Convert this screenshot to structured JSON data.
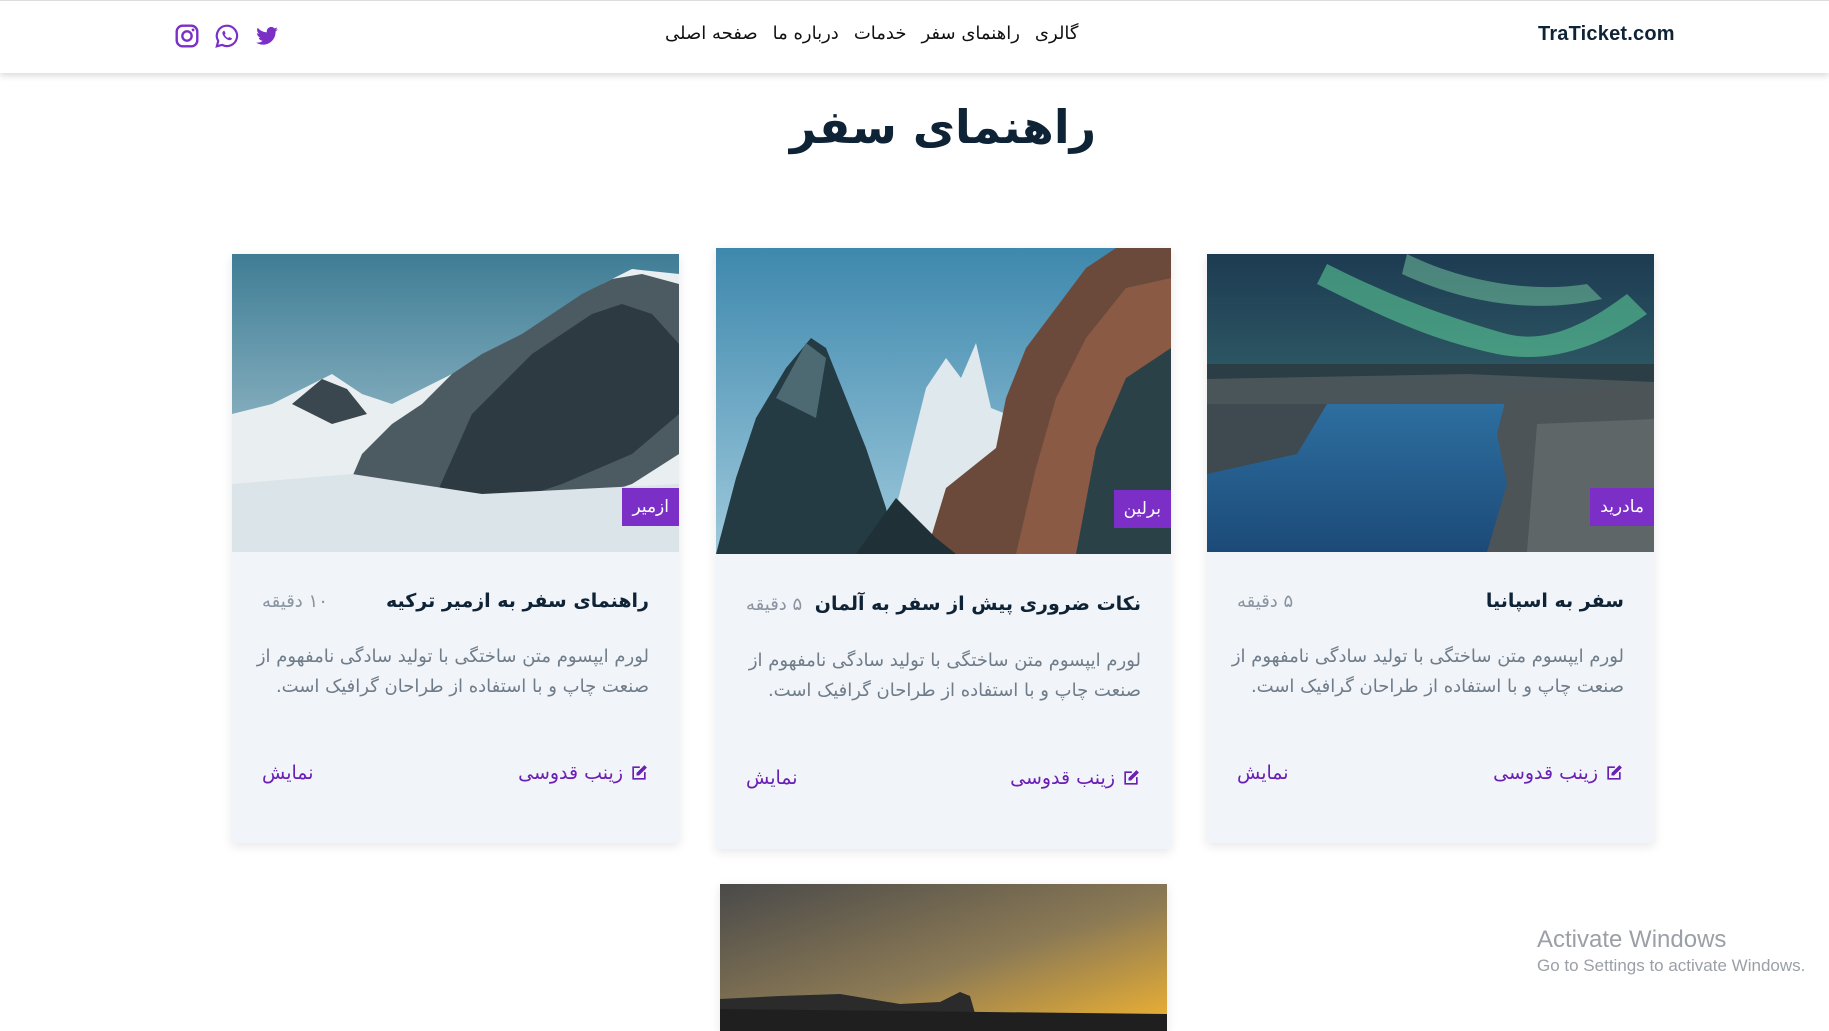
{
  "header": {
    "brand": "TraTicket.com",
    "nav": [
      "صفحه اصلی",
      "درباره ما",
      "خدمات",
      "راهنمای سفر",
      "گالری"
    ],
    "socials": [
      "twitter-icon",
      "whatsapp-icon",
      "instagram-icon"
    ],
    "accent": "#7b2fc6"
  },
  "page": {
    "title": "راهنمای سفر"
  },
  "cards": [
    {
      "tag": "مادرید",
      "title": "سفر به اسپانیا",
      "time": "۵ دقیقه",
      "desc": "لورم ایپسوم متن ساختگی با تولید سادگی نامفهوم از صنعت چاپ و با استفاده از طراحان گرافیک است.",
      "author": "زینب قدوسی",
      "action": "نمایش",
      "image": "aurora-river-photo"
    },
    {
      "tag": "برلین",
      "title": "نکات ضروری پیش از سفر به آلمان",
      "time": "۵ دقیقه",
      "desc": "لورم ایپسوم متن ساختگی با تولید سادگی نامفهوم از صنعت چاپ و با استفاده از طراحان گرافیک است.",
      "author": "زینب قدوسی",
      "action": "نمایش",
      "image": "rocky-peaks-photo"
    },
    {
      "tag": "ازمیر",
      "title": "راهنمای سفر به ازمیر ترکیه",
      "time": "۱۰ دقیقه",
      "desc": "لورم ایپسوم متن ساختگی با تولید سادگی نامفهوم از صنعت چاپ و با استفاده از طراحان گرافیک است.",
      "author": "زینب قدوسی",
      "action": "نمایش",
      "image": "snowy-mountains-photo"
    }
  ],
  "watermark": {
    "line1": "Activate Windows",
    "line2": "Go to Settings to activate Windows."
  }
}
